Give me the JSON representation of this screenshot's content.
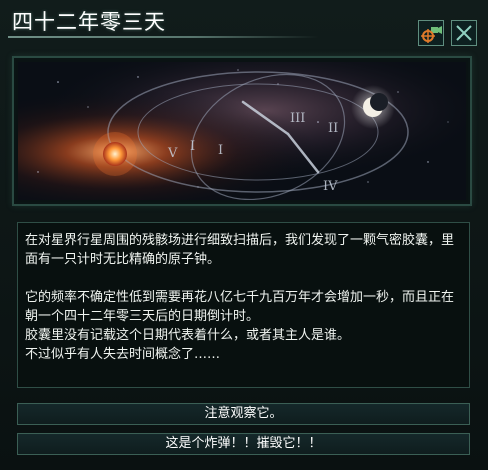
{
  "event": {
    "title": "四十二年零三天",
    "buttons": {
      "video_icon": "camera-target-icon",
      "close_icon": "close-x-icon"
    },
    "banner": {
      "clock_numerals": [
        "V",
        "I",
        "I",
        "III",
        "II",
        "IV"
      ],
      "description_icons": [
        "sun-icon",
        "crescent-moon-icon"
      ]
    },
    "message": {
      "paragraph_1": "在对星界行星周围的残骸场进行细致扫描后，我们发现了一颗气密胶囊，里面有一只计时无比精确的原子钟。",
      "paragraph_2_line_1": "它的频率不确定性低到需要再花八亿七千九百万年才会增加一秒，而且正在朝一个四十二年零三天后的日期倒计时。",
      "paragraph_2_line_2": "胶囊里没有记载这个日期代表着什么，或者其主人是谁。",
      "paragraph_2_line_3": "不过似乎有人失去时间概念了……"
    },
    "choices": [
      {
        "label": "注意观察它。"
      },
      {
        "label": "这是个炸弹！！摧毁它！！"
      }
    ],
    "colors": {
      "accent": "#5f8e7f",
      "background": "#0c1414",
      "text": "#f0f4f0"
    }
  }
}
